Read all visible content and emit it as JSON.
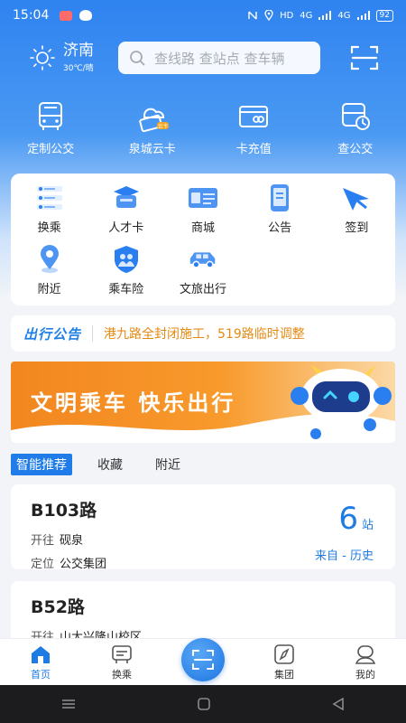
{
  "status_bar": {
    "time": "15:04",
    "network": "HD",
    "signal1": "4G",
    "signal2": "4G",
    "battery": "92"
  },
  "header": {
    "city": "济南",
    "weather": "30℃/晴",
    "search_placeholder": "查线路 查站点 查车辆"
  },
  "quick_actions": [
    {
      "label": "定制公交",
      "icon": "bus-icon"
    },
    {
      "label": "泉城云卡",
      "icon": "cloud-card-icon",
      "badge": "云卡"
    },
    {
      "label": "卡充值",
      "icon": "card-recharge-icon"
    },
    {
      "label": "查公交",
      "icon": "bus-query-icon"
    }
  ],
  "services": [
    {
      "label": "换乘",
      "icon": "transfer-icon"
    },
    {
      "label": "人才卡",
      "icon": "talent-card-icon"
    },
    {
      "label": "商城",
      "icon": "mall-icon"
    },
    {
      "label": "公告",
      "icon": "announcement-icon"
    },
    {
      "label": "签到",
      "icon": "checkin-icon"
    },
    {
      "label": "附近",
      "icon": "nearby-icon"
    },
    {
      "label": "乘车险",
      "icon": "insurance-icon"
    },
    {
      "label": "文旅出行",
      "icon": "tour-car-icon"
    }
  ],
  "notice": {
    "tag": "出行公告",
    "message": "港九路全封闭施工，519路临时调整"
  },
  "banner": {
    "slogan": "文明乘车 快乐出行"
  },
  "tabs": [
    {
      "label": "智能推荐",
      "active": true
    },
    {
      "label": "收藏",
      "active": false
    },
    {
      "label": "附近",
      "active": false
    }
  ],
  "routes": [
    {
      "name": "B103路",
      "dest_label": "开往",
      "dest": "砚泉",
      "loc_label": "定位",
      "loc": "公交集团",
      "eta_value": "6",
      "eta_unit": "站",
      "source": "来自 - 历史"
    },
    {
      "name": "B52路",
      "dest_label": "开往",
      "dest": "山大兴隆山校区"
    }
  ],
  "bottom_nav": [
    {
      "label": "首页",
      "icon": "home-icon",
      "active": true
    },
    {
      "label": "换乘",
      "icon": "transfer-nav-icon",
      "active": false
    },
    {
      "label": "集团",
      "icon": "compass-icon",
      "active": false
    },
    {
      "label": "我的",
      "icon": "profile-icon",
      "active": false
    }
  ],
  "colors": {
    "primary": "#1d7be4",
    "notice_text": "#e48a14",
    "banner": "#f2861f"
  }
}
